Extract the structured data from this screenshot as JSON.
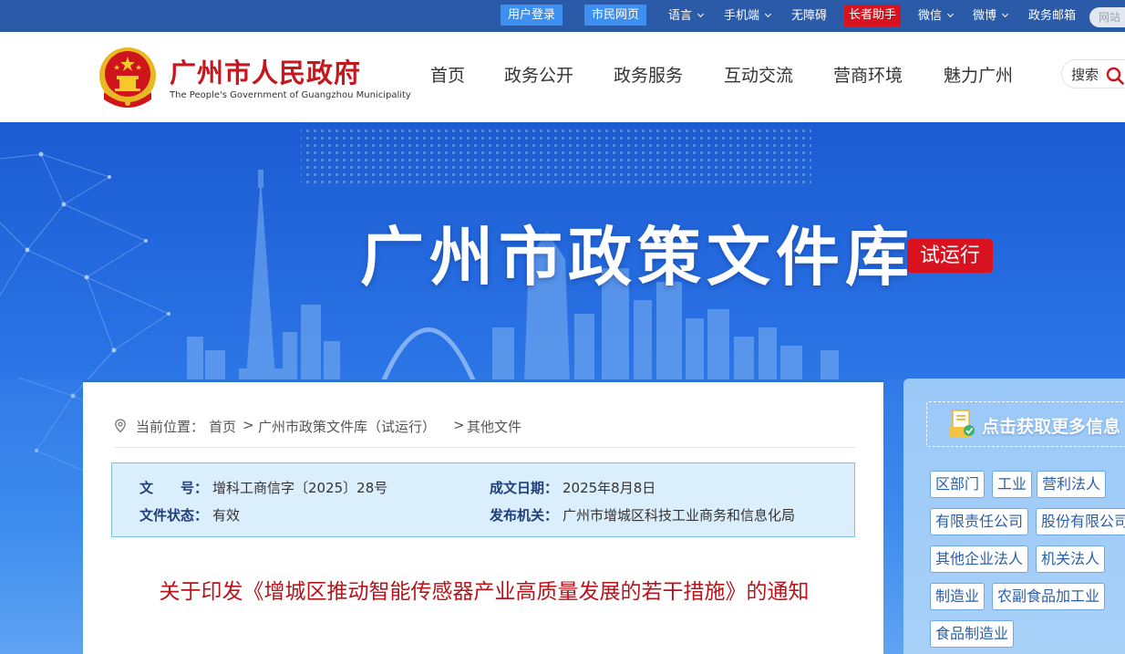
{
  "topbar": {
    "login": "用户登录",
    "citizen": "市民网页",
    "language": "语言",
    "mobile": "手机端",
    "accessibility": "无障碍",
    "elder": "长者助手",
    "wechat": "微信",
    "weibo": "微博",
    "email": "政务邮箱",
    "search_placeholder": "网站"
  },
  "header": {
    "title": "广州市人民政府",
    "subtitle": "The People's Government of Guangzhou Municipality",
    "nav": [
      "首页",
      "政务公开",
      "政务服务",
      "互动交流",
      "营商环境",
      "魅力广州"
    ],
    "search_label": "搜索"
  },
  "banner": {
    "title": "广州市政策文件库",
    "tag": "试运行"
  },
  "breadcrumb": {
    "prefix": "当前位置：",
    "items": [
      "首页",
      "广州市政策文件库（试运行）",
      "其他文件"
    ],
    "sep": ">"
  },
  "meta": {
    "doc_no_label": "文　　号：",
    "doc_no": "增科工商信字〔2025〕28号",
    "date_label": "成文日期：",
    "date": "2025年8月8日",
    "status_label": "文件状态：",
    "status": "有效",
    "issuer_label": "发布机关：",
    "issuer": "广州市增城区科技工业商务和信息化局"
  },
  "document": {
    "title": "关于印发《增城区推动智能传感器产业高质量发展的若干措施》的通知"
  },
  "sidebar": {
    "heading": "点击获取更多信息",
    "tags": [
      "区部门",
      "工业",
      "营利法人",
      "有限责任公司",
      "股份有限公司",
      "其他企业法人",
      "机关法人",
      "制造业",
      "农副食品加工业",
      "食品制造业"
    ]
  },
  "colors": {
    "brand_red": "#c8161d",
    "topbar_blue": "#2a5aa8",
    "banner_blue": "#2a74e6",
    "accent_blue": "#3d8ff0"
  }
}
